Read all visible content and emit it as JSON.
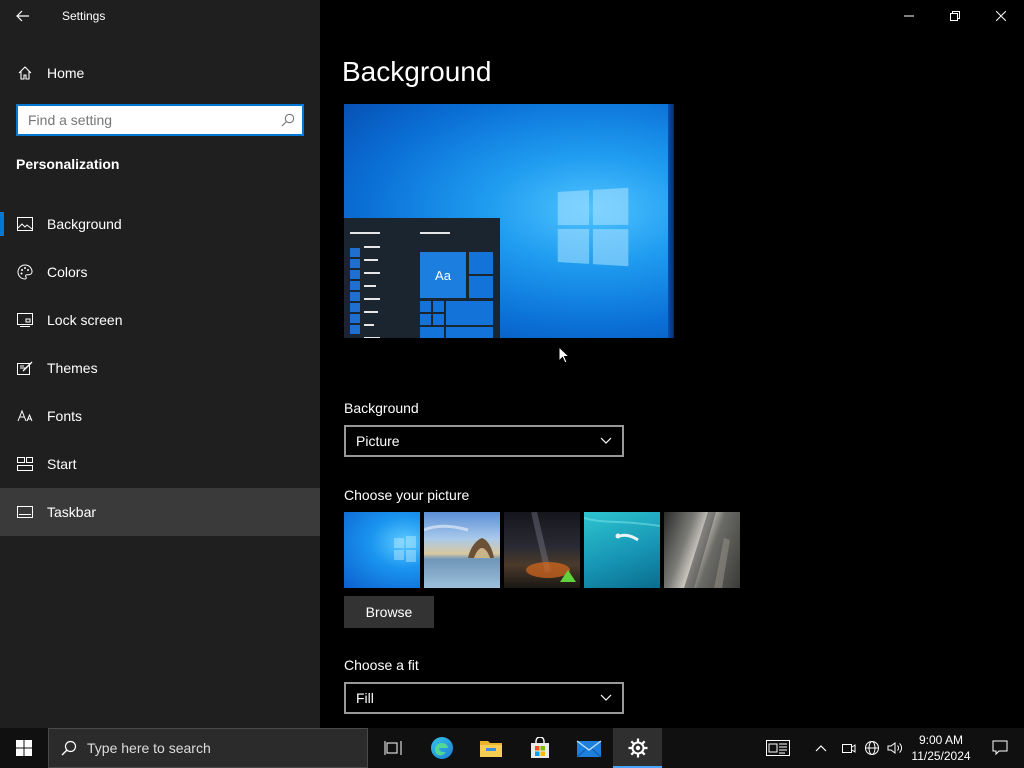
{
  "window": {
    "title": "Settings"
  },
  "sidebar": {
    "home_label": "Home",
    "search_placeholder": "Find a setting",
    "section_title": "Personalization",
    "items": [
      {
        "label": "Background",
        "icon": "picture-icon",
        "selected": true
      },
      {
        "label": "Colors",
        "icon": "palette-icon"
      },
      {
        "label": "Lock screen",
        "icon": "lock-screen-icon"
      },
      {
        "label": "Themes",
        "icon": "themes-icon"
      },
      {
        "label": "Fonts",
        "icon": "fonts-icon"
      },
      {
        "label": "Start",
        "icon": "start-icon"
      },
      {
        "label": "Taskbar",
        "icon": "taskbar-icon",
        "hovered": true
      }
    ]
  },
  "main": {
    "page_title": "Background",
    "preview": {
      "tile_text": "Aa"
    },
    "background_label": "Background",
    "background_value": "Picture",
    "choose_picture_label": "Choose your picture",
    "pictures": [
      "windows-blue",
      "rock-arch-beach",
      "night-sky-tent",
      "underwater-swimmer",
      "rock-cliff"
    ],
    "browse_label": "Browse",
    "choose_fit_label": "Choose a fit",
    "fit_value": "Fill"
  },
  "taskbar": {
    "search_placeholder": "Type here to search",
    "apps": [
      "task-view-icon",
      "edge-icon",
      "file-explorer-icon",
      "store-icon",
      "mail-icon",
      "settings-icon"
    ],
    "active_app": "settings-icon",
    "time": "9:00 AM",
    "date": "11/25/2024"
  },
  "colors": {
    "accent": "#0078d4",
    "sidebar_bg": "#1f1f1f",
    "content_bg": "#000000",
    "taskbar_bg": "#101010"
  }
}
